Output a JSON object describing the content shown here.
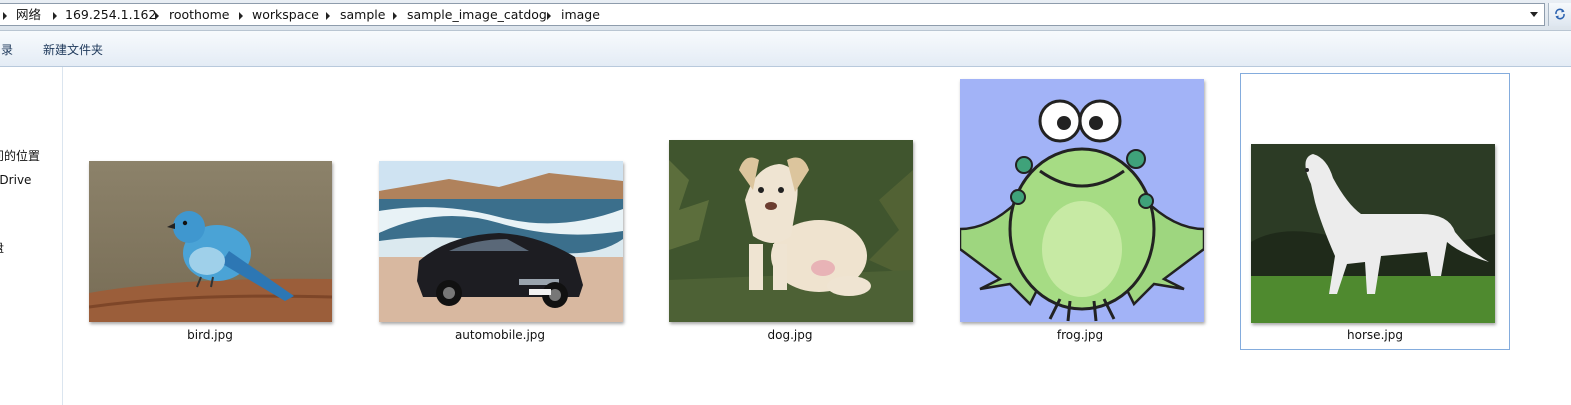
{
  "address_bar": {
    "crumbs": [
      "网络",
      "169.254.1.162",
      "roothome",
      "workspace",
      "sample",
      "sample_image_catdog",
      "image"
    ]
  },
  "toolbar": {
    "partial_item": "目录",
    "new_folder": "新建文件夹"
  },
  "nav_pane": {
    "items": [
      "最近访问的位置",
      "OneDrive",
      "盘"
    ]
  },
  "files": [
    {
      "name": "bird.jpg",
      "icon": "bird-image-thumbnail",
      "selected": false
    },
    {
      "name": "automobile.jpg",
      "icon": "car-image-thumbnail",
      "selected": false
    },
    {
      "name": "dog.jpg",
      "icon": "dog-image-thumbnail",
      "selected": false
    },
    {
      "name": "frog.jpg",
      "icon": "frog-image-thumbnail",
      "selected": false
    },
    {
      "name": "horse.jpg",
      "icon": "horse-image-thumbnail",
      "selected": true
    }
  ],
  "colors": {
    "selection_border": "#84acdd",
    "toolbar_text": "#1e395b"
  }
}
